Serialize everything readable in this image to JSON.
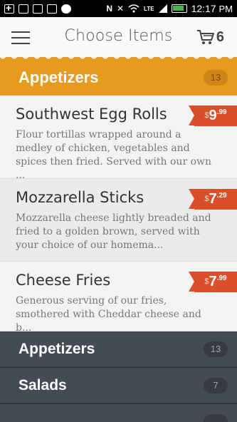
{
  "status_bar": {
    "time": "12:17",
    "ampm": "PM",
    "icons": [
      "plus-icon",
      "mail-icon",
      "code-icon",
      "code-icon",
      "check-icon",
      "nfc-icon",
      "mute-icon",
      "wifi-icon",
      "lte-icon",
      "signal-icon",
      "battery-icon"
    ]
  },
  "header": {
    "title": "Choose Items",
    "cart_count": "6"
  },
  "expanded_category": {
    "name": "Appetizers",
    "count": "13"
  },
  "items": [
    {
      "name": "Southwest Egg Rolls",
      "description": "Flour tortillas wrapped around a medley of chicken, vegetables and spices then fried. Served with our own ...",
      "currency": "$",
      "dollars": "9",
      "cents": ".99"
    },
    {
      "name": "Mozzarella Sticks",
      "description": "Mozzarella cheese lightly breaded and fried to a golden brown, served with your choice of our homema...",
      "currency": "$",
      "dollars": "7",
      "cents": ".29"
    },
    {
      "name": "Cheese Fries",
      "description": "Generous serving of our fries, smothered with Cheddar cheese and b...",
      "currency": "$",
      "dollars": "7",
      "cents": ".99"
    }
  ],
  "categories": [
    {
      "name": "Appetizers",
      "count": "13"
    },
    {
      "name": "Salads",
      "count": "7"
    }
  ],
  "colors": {
    "accent": "#e69a1f",
    "price_tag": "#d94f2a",
    "category_bg": "#454b55"
  }
}
